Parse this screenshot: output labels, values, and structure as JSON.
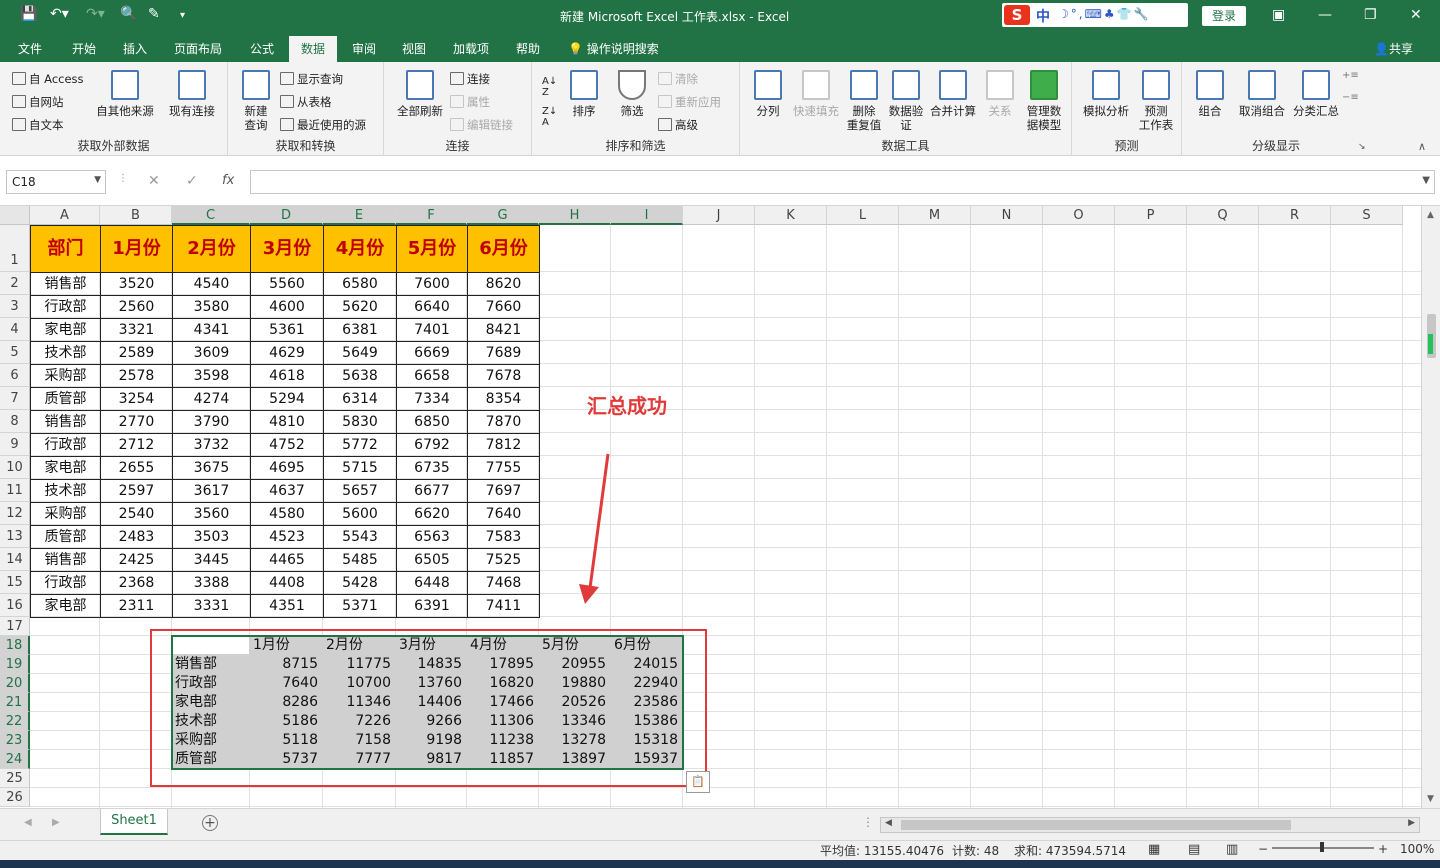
{
  "window": {
    "title": "新建 Microsoft Excel 工作表.xlsx  -  Excel",
    "login": "登录",
    "share": "共享",
    "ime": {
      "logo": "S",
      "zh": "中",
      "rest": "☽°,⌨♣👕🔧"
    }
  },
  "tabs": [
    "文件",
    "开始",
    "插入",
    "页面布局",
    "公式",
    "数据",
    "审阅",
    "视图",
    "加载项",
    "帮助",
    "操作说明搜索"
  ],
  "active_tab": "数据",
  "ribbon": {
    "external": {
      "label": "获取外部数据",
      "access": "自 Access",
      "web": "自网站",
      "text": "自文本",
      "other": "自其他来源",
      "existing": "现有连接"
    },
    "transform": {
      "label": "获取和转换",
      "new_query": "新建\n查询",
      "show_query": "显示查询",
      "from_table": "从表格",
      "recent": "最近使用的源"
    },
    "connections": {
      "label": "连接",
      "refresh_all": "全部刷新",
      "connections": "连接",
      "properties": "属性",
      "edit_links": "编辑链接"
    },
    "sort": {
      "label": "排序和筛选",
      "sort": "排序",
      "filter": "筛选",
      "clear": "清除",
      "reapply": "重新应用",
      "advanced": "高级"
    },
    "tools": {
      "label": "数据工具",
      "split": "分列",
      "flash": "快速填充",
      "remove_dup": "删除\n重复值",
      "validate": "数据验\n证",
      "consolidate": "合并计算",
      "relations": "关系",
      "model": "管理数\n据模型"
    },
    "forecast": {
      "label": "预测",
      "whatif": "模拟分析",
      "sheet": "预测\n工作表"
    },
    "outline": {
      "label": "分级显示",
      "group": "组合",
      "ungroup": "取消组合",
      "subtotal": "分类汇总"
    }
  },
  "formula_bar": {
    "name_box": "C18",
    "fx": "fx",
    "formula": ""
  },
  "columns": [
    "A",
    "B",
    "C",
    "D",
    "E",
    "F",
    "G",
    "H",
    "I",
    "J",
    "K",
    "L",
    "M",
    "N",
    "O",
    "P",
    "Q",
    "R",
    "S"
  ],
  "rows": [
    "1",
    "2",
    "3",
    "4",
    "5",
    "6",
    "7",
    "8",
    "9",
    "10",
    "11",
    "12",
    "13",
    "14",
    "15",
    "16",
    "17",
    "18",
    "19",
    "20",
    "21",
    "22",
    "23",
    "24",
    "25",
    "26"
  ],
  "table": {
    "headers": [
      "部门",
      "1月份",
      "2月份",
      "3月份",
      "4月份",
      "5月份",
      "6月份"
    ],
    "rows": [
      [
        "销售部",
        "3520",
        "4540",
        "5560",
        "6580",
        "7600",
        "8620"
      ],
      [
        "行政部",
        "2560",
        "3580",
        "4600",
        "5620",
        "6640",
        "7660"
      ],
      [
        "家电部",
        "3321",
        "4341",
        "5361",
        "6381",
        "7401",
        "8421"
      ],
      [
        "技术部",
        "2589",
        "3609",
        "4629",
        "5649",
        "6669",
        "7689"
      ],
      [
        "采购部",
        "2578",
        "3598",
        "4618",
        "5638",
        "6658",
        "7678"
      ],
      [
        "质管部",
        "3254",
        "4274",
        "5294",
        "6314",
        "7334",
        "8354"
      ],
      [
        "销售部",
        "2770",
        "3790",
        "4810",
        "5830",
        "6850",
        "7870"
      ],
      [
        "行政部",
        "2712",
        "3732",
        "4752",
        "5772",
        "6792",
        "7812"
      ],
      [
        "家电部",
        "2655",
        "3675",
        "4695",
        "5715",
        "6735",
        "7755"
      ],
      [
        "技术部",
        "2597",
        "3617",
        "4637",
        "5657",
        "6677",
        "7697"
      ],
      [
        "采购部",
        "2540",
        "3560",
        "4580",
        "5600",
        "6620",
        "7640"
      ],
      [
        "质管部",
        "2483",
        "3503",
        "4523",
        "5543",
        "6563",
        "7583"
      ],
      [
        "销售部",
        "2425",
        "3445",
        "4465",
        "5485",
        "6505",
        "7525"
      ],
      [
        "行政部",
        "2368",
        "3388",
        "4408",
        "5428",
        "6448",
        "7468"
      ],
      [
        "家电部",
        "2311",
        "3331",
        "4351",
        "5371",
        "6391",
        "7411"
      ]
    ]
  },
  "consolidated": {
    "headers": [
      "",
      "1月份",
      "2月份",
      "3月份",
      "4月份",
      "5月份",
      "6月份"
    ],
    "rows": [
      [
        "销售部",
        "8715",
        "11775",
        "14835",
        "17895",
        "20955",
        "24015"
      ],
      [
        "行政部",
        "7640",
        "10700",
        "13760",
        "16820",
        "19880",
        "22940"
      ],
      [
        "家电部",
        "8286",
        "11346",
        "14406",
        "17466",
        "20526",
        "23586"
      ],
      [
        "技术部",
        "5186",
        "7226",
        "9266",
        "11306",
        "13346",
        "15386"
      ],
      [
        "采购部",
        "5118",
        "7158",
        "9198",
        "11238",
        "13278",
        "15318"
      ],
      [
        "质管部",
        "5737",
        "7777",
        "9817",
        "11857",
        "13897",
        "15937"
      ]
    ]
  },
  "annotation": "汇总成功",
  "sheet_tab": "Sheet1",
  "status": {
    "average": "平均值: 13155.40476",
    "count": "计数: 48",
    "sum": "求和: 473594.5714",
    "zoom": "100%"
  },
  "colors": {
    "excel_green": "#217346",
    "header_fill": "#ffc000",
    "header_text": "#c00000",
    "annotation_red": "#e03a3a",
    "selection_gray": "#d0d0d0"
  }
}
